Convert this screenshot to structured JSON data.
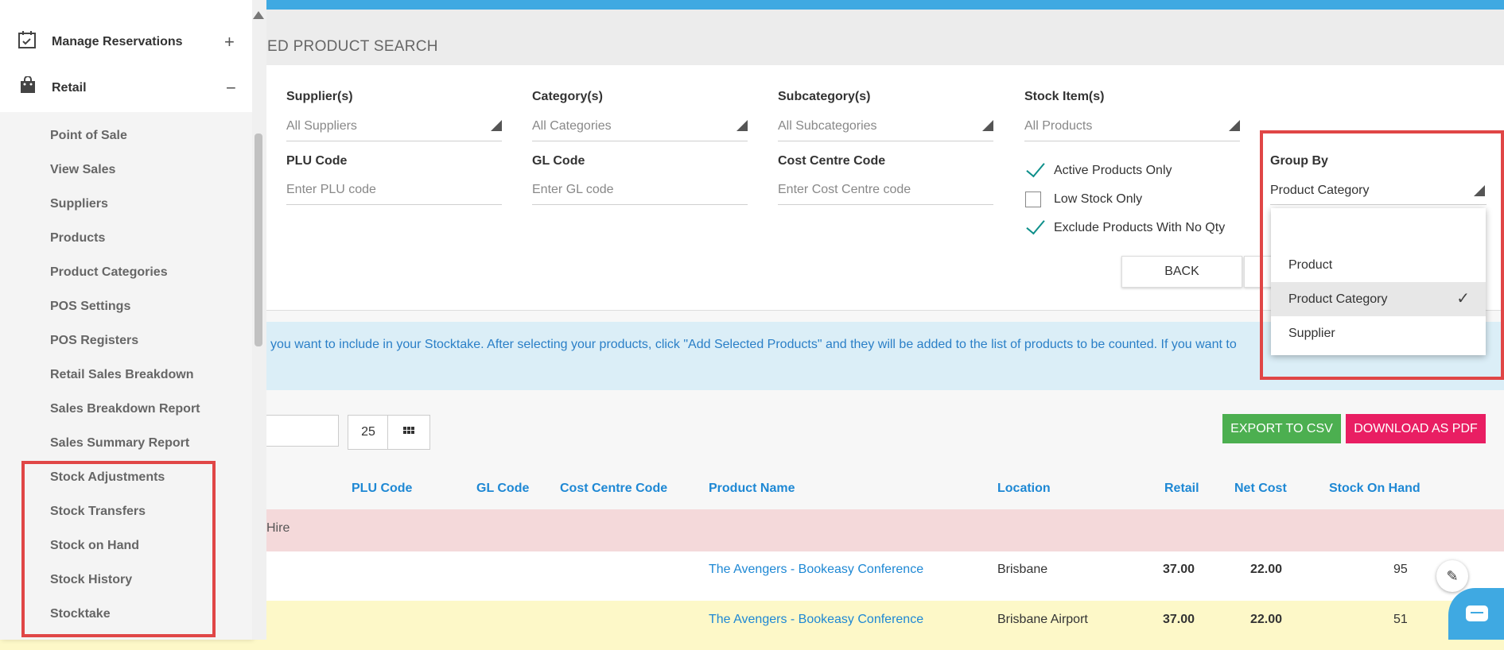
{
  "header": {
    "title": "ED PRODUCT SEARCH"
  },
  "filters": {
    "supplier": {
      "label": "Supplier(s)",
      "value": "All Suppliers"
    },
    "category": {
      "label": "Category(s)",
      "value": "All Categories"
    },
    "subcategory": {
      "label": "Subcategory(s)",
      "value": "All Subcategories"
    },
    "stock_item": {
      "label": "Stock Item(s)",
      "value": "All Products"
    },
    "plu": {
      "label": "PLU Code",
      "placeholder": "Enter PLU code"
    },
    "gl": {
      "label": "GL Code",
      "placeholder": "Enter GL code"
    },
    "cost_centre": {
      "label": "Cost Centre Code",
      "placeholder": "Enter Cost Centre code"
    },
    "checks": {
      "active": {
        "label": "Active Products Only",
        "checked": true
      },
      "low_stock": {
        "label": "Low Stock Only",
        "checked": false
      },
      "exclude_no_qty": {
        "label": "Exclude Products With No Qty",
        "checked": true
      }
    },
    "group_by": {
      "label": "Group By",
      "value": "Product Category",
      "options": [
        "Product",
        "Product Category",
        "Supplier"
      ]
    },
    "back_label": "BACK"
  },
  "info": {
    "text": "you want to include in your Stocktake. After selecting your products, click \"Add Selected Products\" and they will be added to the list of products to be counted. If you want to"
  },
  "toolbar": {
    "page_size": "25",
    "export_csv": "EXPORT TO CSV",
    "download_pdf": "DOWNLOAD AS PDF"
  },
  "table": {
    "headers": [
      "PLU Code",
      "GL Code",
      "Cost Centre Code",
      "Product Name",
      "Location",
      "Retail",
      "Net Cost",
      "Stock On Hand"
    ],
    "group_label": "Hire",
    "rows": [
      {
        "product": "The Avengers - Bookeasy Conference",
        "location": "Brisbane",
        "retail": "37.00",
        "net_cost": "22.00",
        "stock": "95"
      },
      {
        "product": "The Avengers - Bookeasy Conference",
        "location": "Brisbane Airport",
        "retail": "37.00",
        "net_cost": "22.00",
        "stock": "51"
      }
    ]
  },
  "sidebar": {
    "main_items": [
      {
        "label": "Manage Reservations",
        "icon": "calendar-check-icon",
        "toggle": "+"
      },
      {
        "label": "Retail",
        "icon": "shopping-bag-icon",
        "toggle": "−"
      }
    ],
    "retail_items": [
      "Point of Sale",
      "View Sales",
      "Suppliers",
      "Products",
      "Product Categories",
      "POS Settings",
      "POS Registers",
      "Retail Sales Breakdown",
      "Sales Breakdown Report",
      "Sales Summary Report",
      "Stock Adjustments",
      "Stock Transfers",
      "Stock on Hand",
      "Stock History",
      "Stocktake"
    ]
  },
  "colors": {
    "topbar": "#3fa9e2",
    "export_csv": "#4caf50",
    "download_pdf": "#e91e63",
    "highlight": "#e04646",
    "link": "#1e88d4"
  }
}
